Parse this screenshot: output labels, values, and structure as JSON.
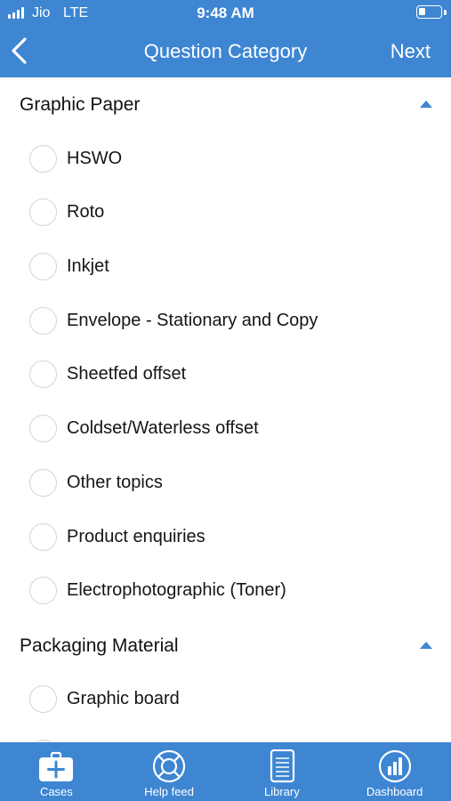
{
  "status_bar": {
    "carrier": "Jio",
    "network": "LTE",
    "time": "9:48 AM",
    "battery_level": 0.3
  },
  "nav": {
    "back_icon": "chevron-left-icon",
    "title": "Question Category",
    "next_label": "Next"
  },
  "sections": [
    {
      "title": "Graphic Paper",
      "expanded": true,
      "options": [
        "HSWO",
        "Roto",
        "Inkjet",
        "Envelope - Stationary and Copy",
        "Sheetfed offset",
        "Coldset/Waterless offset",
        "Other topics",
        "Product enquiries",
        "Electrophotographic (Toner)"
      ]
    },
    {
      "title": "Packaging Material",
      "expanded": true,
      "options": [
        "Graphic board"
      ]
    }
  ],
  "tabs": [
    {
      "label": "Cases",
      "icon": "medical-case-icon"
    },
    {
      "label": "Help feed",
      "icon": "lifebuoy-icon"
    },
    {
      "label": "Library",
      "icon": "document-icon"
    },
    {
      "label": "Dashboard",
      "icon": "bar-chart-icon"
    }
  ],
  "colors": {
    "primary": "#3e86d2",
    "background": "#ffffff",
    "text": "#151515",
    "radio_border": "#d4d4d4"
  }
}
